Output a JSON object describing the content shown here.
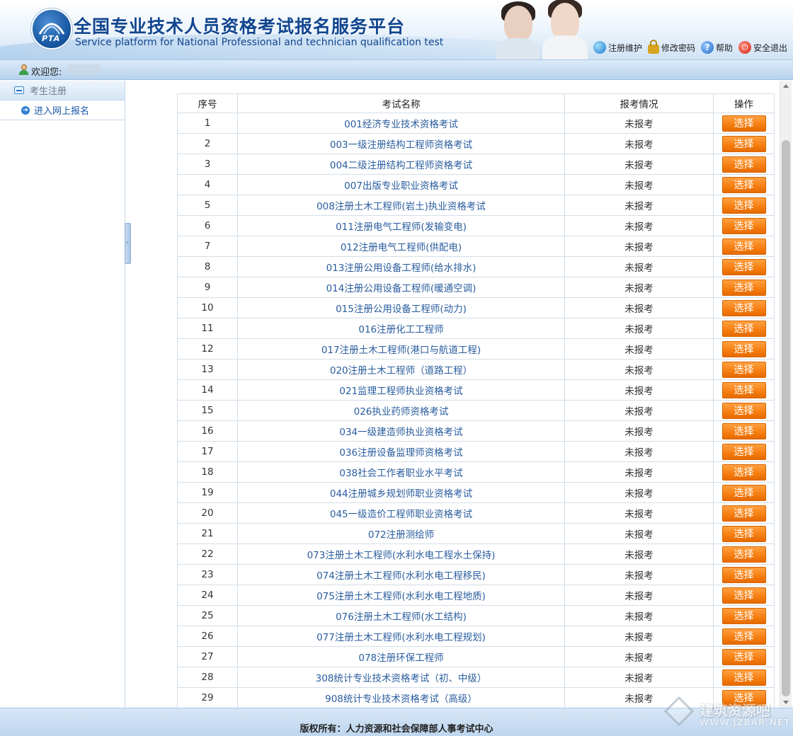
{
  "header": {
    "title": "全国专业技术人员资格考试报名服务平台",
    "subtitle": "Service platform for National Professional and technician qualification test",
    "logo_text": "PTA",
    "links": [
      {
        "label": "注册维护",
        "icon": "globe-icon"
      },
      {
        "label": "修改密码",
        "icon": "lock-icon"
      },
      {
        "label": "帮助",
        "icon": "help-icon"
      },
      {
        "label": "安全退出",
        "icon": "power-icon"
      }
    ]
  },
  "welcome": {
    "label": "欢迎您:"
  },
  "sidebar": {
    "section": "考生注册",
    "items": [
      {
        "label": "进入网上报名"
      }
    ]
  },
  "table": {
    "headers": [
      "序号",
      "考试名称",
      "报考情况",
      "操作"
    ],
    "button_label": "选择",
    "rows": [
      {
        "no": "1",
        "name": "001经济专业技术资格考试",
        "status": "未报考"
      },
      {
        "no": "2",
        "name": "003一级注册结构工程师资格考试",
        "status": "未报考"
      },
      {
        "no": "3",
        "name": "004二级注册结构工程师资格考试",
        "status": "未报考"
      },
      {
        "no": "4",
        "name": "007出版专业职业资格考试",
        "status": "未报考"
      },
      {
        "no": "5",
        "name": "008注册土木工程师(岩土)执业资格考试",
        "status": "未报考"
      },
      {
        "no": "6",
        "name": "011注册电气工程师(发输变电)",
        "status": "未报考"
      },
      {
        "no": "7",
        "name": "012注册电气工程师(供配电)",
        "status": "未报考"
      },
      {
        "no": "8",
        "name": "013注册公用设备工程师(给水排水)",
        "status": "未报考"
      },
      {
        "no": "9",
        "name": "014注册公用设备工程师(暖通空调)",
        "status": "未报考"
      },
      {
        "no": "10",
        "name": "015注册公用设备工程师(动力)",
        "status": "未报考"
      },
      {
        "no": "11",
        "name": "016注册化工工程师",
        "status": "未报考"
      },
      {
        "no": "12",
        "name": "017注册土木工程师(港口与航道工程)",
        "status": "未报考"
      },
      {
        "no": "13",
        "name": "020注册土木工程师（道路工程）",
        "status": "未报考"
      },
      {
        "no": "14",
        "name": "021监理工程师执业资格考试",
        "status": "未报考"
      },
      {
        "no": "15",
        "name": "026执业药师资格考试",
        "status": "未报考"
      },
      {
        "no": "16",
        "name": "034一级建造师执业资格考试",
        "status": "未报考"
      },
      {
        "no": "17",
        "name": "036注册设备监理师资格考试",
        "status": "未报考"
      },
      {
        "no": "18",
        "name": "038社会工作者职业水平考试",
        "status": "未报考"
      },
      {
        "no": "19",
        "name": "044注册城乡规划师职业资格考试",
        "status": "未报考"
      },
      {
        "no": "20",
        "name": "045一级造价工程师职业资格考试",
        "status": "未报考"
      },
      {
        "no": "21",
        "name": "072注册测绘师",
        "status": "未报考"
      },
      {
        "no": "22",
        "name": "073注册土木工程师(水利水电工程水土保持)",
        "status": "未报考"
      },
      {
        "no": "23",
        "name": "074注册土木工程师(水利水电工程移民)",
        "status": "未报考"
      },
      {
        "no": "24",
        "name": "075注册土木工程师(水利水电工程地质)",
        "status": "未报考"
      },
      {
        "no": "25",
        "name": "076注册土木工程师(水工结构)",
        "status": "未报考"
      },
      {
        "no": "26",
        "name": "077注册土木工程师(水利水电工程规划)",
        "status": "未报考"
      },
      {
        "no": "27",
        "name": "078注册环保工程师",
        "status": "未报考"
      },
      {
        "no": "28",
        "name": "308统计专业技术资格考试（初、中级）",
        "status": "未报考"
      },
      {
        "no": "29",
        "name": "908统计专业技术资格考试（高级）",
        "status": "未报考"
      }
    ]
  },
  "footer": {
    "copyright": "版权所有：人力资源和社会保障部人事考试中心"
  },
  "watermark": {
    "text": "建筑资源吧",
    "url": "WWW.JZBAR.NET"
  },
  "colors": {
    "accent": "#f57d10",
    "brand": "#11468f",
    "link": "#2a5d9e"
  }
}
